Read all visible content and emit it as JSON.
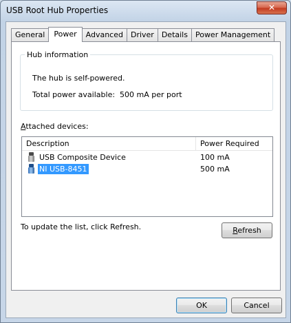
{
  "window": {
    "title": "USB Root Hub Properties",
    "close_glyph": "✕"
  },
  "tabs": [
    {
      "label": "General"
    },
    {
      "label": "Power",
      "active": true
    },
    {
      "label": "Advanced"
    },
    {
      "label": "Driver"
    },
    {
      "label": "Details"
    },
    {
      "label": "Power Management"
    }
  ],
  "hub_info": {
    "legend": "Hub information",
    "self_powered": "The hub is self-powered.",
    "total_power_label": "Total power available:",
    "total_power_value": "500 mA per port"
  },
  "attached": {
    "label_first": "A",
    "label_rest": "ttached devices:",
    "columns": [
      "Description",
      "Power Required"
    ],
    "rows": [
      {
        "description": "USB Composite Device",
        "power": "100 mA",
        "icon": "usb-plug-gray-icon",
        "selected": false
      },
      {
        "description": "NI USB-8451",
        "power": "500 mA",
        "icon": "usb-plug-blue-icon",
        "selected": true
      }
    ]
  },
  "update_text": "To update the list, click Refresh.",
  "buttons": {
    "refresh_first": "R",
    "refresh_rest": "efresh",
    "ok": "OK",
    "cancel": "Cancel"
  },
  "colors": {
    "selection": "#3399ff",
    "titlebar": "#c2d3e6",
    "close": "#c1391f"
  }
}
